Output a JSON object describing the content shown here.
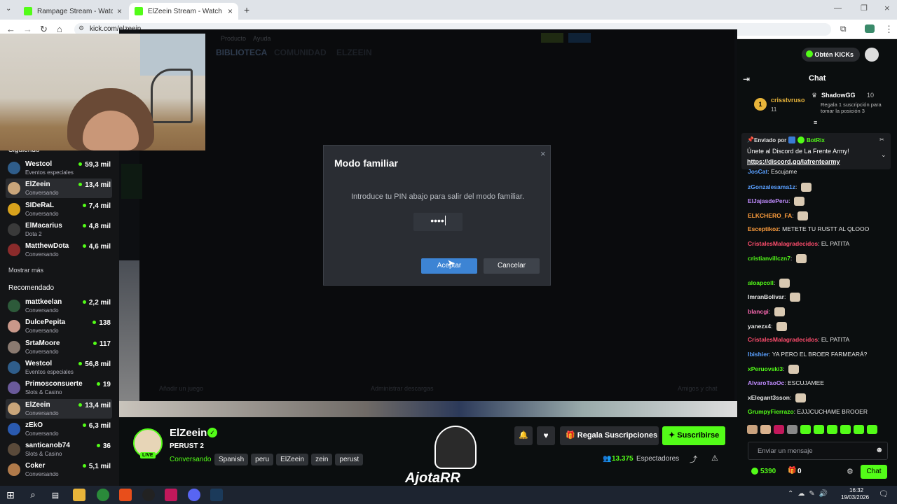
{
  "browser": {
    "tabs": [
      {
        "title": "Rampage Stream - Watch Live o"
      },
      {
        "title": "ElZeein Stream - Watch Live on"
      }
    ],
    "new_tab": "+",
    "url": "kick.com/elzeein"
  },
  "steam": {
    "menu_items": [
      "Producto",
      "Ayuda"
    ],
    "nav_tabs": [
      "BIBLIOTECA",
      "COMUNIDAD",
      "ELZEEIN"
    ],
    "footer_left": "Añadir un juego",
    "footer_mid": "Administrar descargas",
    "footer_right": "Amigos y chat",
    "dialog": {
      "title": "Modo familiar",
      "close": "×",
      "instruction": "Introduce tu PIN abajo para salir del modo familiar.",
      "pin_value": "••••",
      "accept": "Aceptar",
      "cancel": "Cancelar"
    }
  },
  "sidebar": {
    "following_label": "Siguiendo",
    "show_more": "Mostrar más",
    "recommended_label": "Recomendado",
    "following": [
      {
        "name": "Westcol",
        "category": "Eventos especiales",
        "viewers": "59,3 mil",
        "color": "#2f5d8a"
      },
      {
        "name": "ElZeein",
        "category": "Conversando",
        "viewers": "13,4 mil",
        "color": "#c9a57a"
      },
      {
        "name": "SIDeRaL",
        "category": "Conversando",
        "viewers": "7,4 mil",
        "color": "#d8a21c"
      },
      {
        "name": "ElMacarius",
        "category": "Dota 2",
        "viewers": "4,8 mil",
        "color": "#3a3a3a"
      },
      {
        "name": "MatthewDota",
        "category": "Conversando",
        "viewers": "4,6 mil",
        "color": "#8b2b2b"
      }
    ],
    "recommended": [
      {
        "name": "mattkeelan",
        "category": "Conversando",
        "viewers": "2,2 mil",
        "color": "#2d5a3a"
      },
      {
        "name": "DulcePepita",
        "category": "Conversando",
        "viewers": "138",
        "color": "#c9988a"
      },
      {
        "name": "SrtaMoore",
        "category": "Conversando",
        "viewers": "117",
        "color": "#8a7a70"
      },
      {
        "name": "Westcol",
        "category": "Eventos especiales",
        "viewers": "56,8 mil",
        "color": "#2f5d8a"
      },
      {
        "name": "Primosconsuerte",
        "category": "Slots & Casino",
        "viewers": "19",
        "color": "#6a5a9a"
      },
      {
        "name": "ElZeein",
        "category": "Conversando",
        "viewers": "13,4 mil",
        "color": "#c9a57a"
      },
      {
        "name": "zEkO",
        "category": "Conversando",
        "viewers": "6,3 mil",
        "color": "#2a5ab0"
      },
      {
        "name": "santicanob74",
        "category": "Slots & Casino",
        "viewers": "36",
        "color": "#5a4a3a"
      },
      {
        "name": "Coker",
        "category": "Conversando",
        "viewers": "5,1 mil",
        "color": "#b07a4a"
      }
    ]
  },
  "channel": {
    "name": "ElZeein",
    "live_badge": "LIVE",
    "title": "PERUST 2",
    "category": "Conversando",
    "tags": [
      "Spanish",
      "peru",
      "ElZeein",
      "zein",
      "perust"
    ],
    "gift_subs": "Regala Suscripciones",
    "subscribe": "Suscribirse",
    "viewers": "13.375",
    "viewers_label": "Espectadores",
    "overlay_name": "AjotaRR"
  },
  "chat": {
    "get_kicks": "Obtén KICKs",
    "title": "Chat",
    "leader1_rank": "1",
    "leader1_name": "crisstvruso",
    "leader1_count": "11",
    "leader2_name": "ShadowGG",
    "leader2_count": "10",
    "leader2_desc": "Regala 1 suscripción para tomar la posición 3",
    "pinned_sent_by": "Enviado por",
    "pinned_bot": "BotRix",
    "pinned_text": "Únete al Discord de La Frente Army!",
    "pinned_link": "https://discord.gg/lafrentearmy",
    "messages": [
      {
        "user": "JosCat",
        "text": "Escujame",
        "color": "#5aa0ff"
      },
      {
        "user": "zGonzalesama1z",
        "text": "",
        "color": "#5aa0ff"
      },
      {
        "user": "ElJajasdePeru",
        "text": "",
        "color": "#c08cff"
      },
      {
        "user": "ELKCHERO_FA",
        "text": "",
        "color": "#ff9e3d"
      },
      {
        "user": "Esceptikoz",
        "text": "METETE TU RUSTT AL QLOOO",
        "color": "#ff9e3d"
      },
      {
        "user": "CristalesMalagradecidos",
        "text": "EL PATITA",
        "color": "#ff4d6d"
      },
      {
        "user": "cristianvillczn7",
        "text": "",
        "color": "#53fc18"
      },
      {
        "user": "aloapcoll",
        "text": "",
        "color": "#53fc18"
      },
      {
        "user": "ImranBolivar",
        "text": "",
        "color": "#e6e6e6"
      },
      {
        "user": "blancgi",
        "text": "",
        "color": "#ff6bb5"
      },
      {
        "user": "yanezx4",
        "text": "",
        "color": "#e6e6e6"
      },
      {
        "user": "CristalesMalagradecidos",
        "text": "EL PATITA",
        "color": "#ff4d6d"
      },
      {
        "user": "Ibishier",
        "text": "YA PERO EL BROER FARMEARÁ?",
        "color": "#5aa0ff"
      },
      {
        "user": "xPeruovski3",
        "text": "",
        "color": "#53fc18"
      },
      {
        "user": "AlvaroTaoOc",
        "text": "ESCUJAMEE",
        "color": "#c08cff"
      },
      {
        "user": "xElegant3sson",
        "text": "",
        "color": "#e6e6e6"
      },
      {
        "user": "GrumpyFierrazo",
        "text": "EJJJCUCHAME BROOER",
        "color": "#53fc18"
      }
    ],
    "input_placeholder": "Enviar un mensaje",
    "kicks_balance": "5390",
    "gift_count": "0",
    "send_label": "Chat"
  },
  "taskbar": {
    "time": "16:32",
    "date": "19/03/2026"
  }
}
